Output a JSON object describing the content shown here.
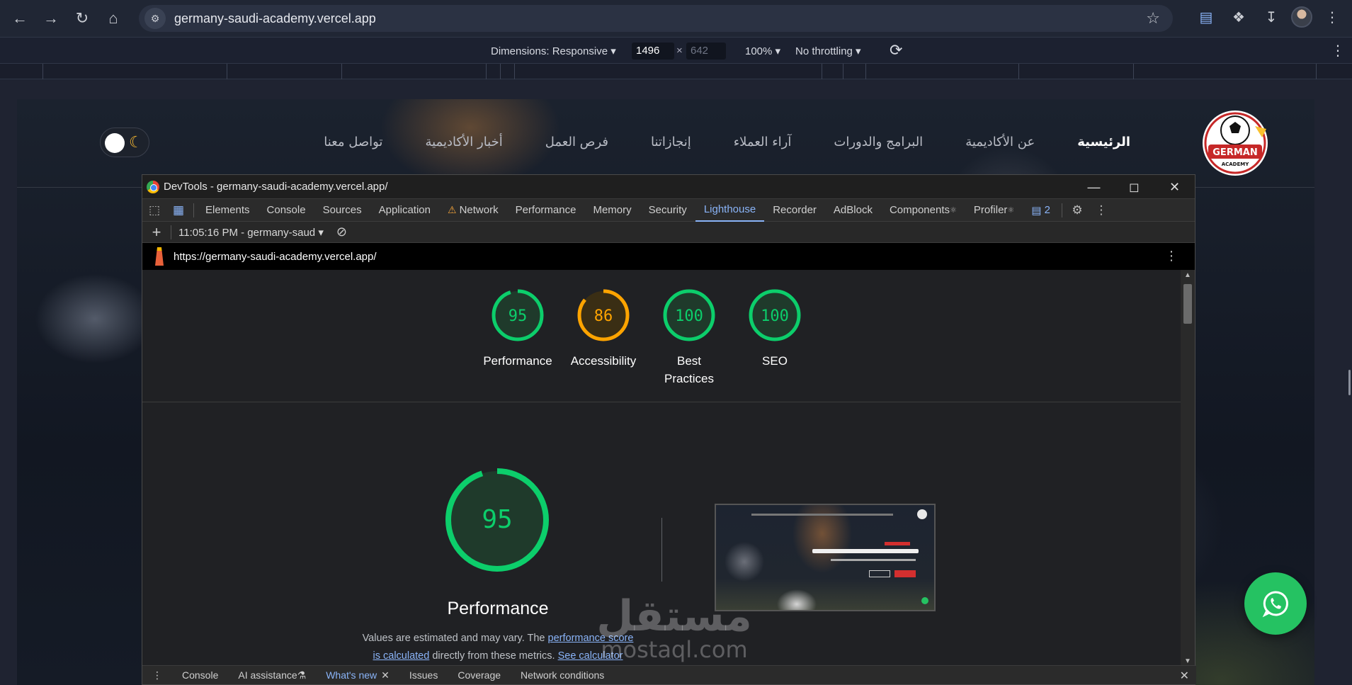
{
  "browser": {
    "url": "germany-saudi-academy.vercel.app",
    "icons": [
      "back-icon",
      "forward-icon",
      "reload-icon",
      "home-icon",
      "site-info-icon",
      "star-icon",
      "radio-icon",
      "extensions-icon",
      "download-icon",
      "profile-avatar",
      "kebab-menu-icon"
    ]
  },
  "device_toolbar": {
    "dimensions_label": "Dimensions: Responsive",
    "width": "1496",
    "height": "642",
    "x_sep": "×",
    "zoom": "100%",
    "throttling": "No throttling"
  },
  "site": {
    "nav": [
      "الرئيسية",
      "عن الأكاديمية",
      "البرامج والدورات",
      "آراء العملاء",
      "إنجازاتنا",
      "فرص العمل",
      "أخبار الأكاديمية",
      "تواصل معنا"
    ],
    "active_nav_index": 0,
    "logo_text_1": "GERMAN",
    "logo_text_2": "ACADEMY",
    "accent_color": "#25c262"
  },
  "devtools": {
    "window_title": "DevTools - germany-saudi-academy.vercel.app/",
    "tabs": [
      "Elements",
      "Console",
      "Sources",
      "Application",
      "Network",
      "Performance",
      "Memory",
      "Security",
      "Lighthouse",
      "Recorder",
      "AdBlock",
      "Components",
      "Profiler"
    ],
    "active_tab": "Lighthouse",
    "issues_count": "2",
    "report_selector": "11:05:16 PM - germany-saud",
    "report_url": "https://germany-saudi-academy.vercel.app/",
    "scores": [
      {
        "label": "Performance",
        "score": "95",
        "value": 95,
        "color": "#0cce6b"
      },
      {
        "label": "Accessibility",
        "score": "86",
        "value": 86,
        "color": "#ffa400"
      },
      {
        "label": "Best Practices",
        "score": "100",
        "value": 100,
        "color": "#0cce6b"
      },
      {
        "label": "SEO",
        "score": "100",
        "value": 100,
        "color": "#0cce6b"
      }
    ],
    "main_score": {
      "label": "Performance",
      "score": "95",
      "value": 95,
      "color": "#0cce6b"
    },
    "note_text_1": "Values are estimated and may vary. The ",
    "note_link_1": "performance score",
    "note_link_2": "is calculated",
    "note_text_2": " directly from these metrics. ",
    "note_link_3": "See calculator",
    "drawer_tabs": [
      "Console",
      "AI assistance",
      "What's new",
      "Issues",
      "Coverage",
      "Network conditions"
    ],
    "active_drawer_tab": "What's new"
  },
  "watermark": {
    "arabic": "مستقل",
    "latin": "mostaql.com"
  }
}
